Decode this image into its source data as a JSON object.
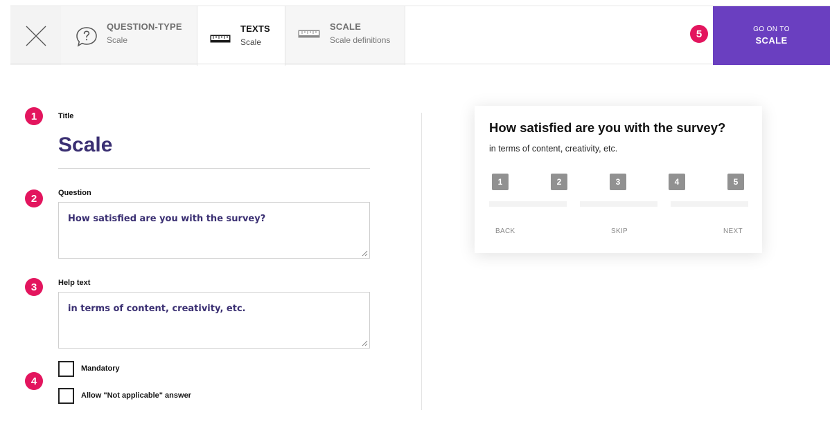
{
  "header": {
    "steps": [
      {
        "title": "QUESTION-TYPE",
        "subtitle": "Scale"
      },
      {
        "title": "TEXTS",
        "subtitle": "Scale"
      },
      {
        "title": "SCALE",
        "subtitle": "Scale definitions"
      }
    ],
    "goon_line1": "GO ON TO",
    "goon_line2": "SCALE"
  },
  "badges": [
    "1",
    "2",
    "3",
    "4",
    "5"
  ],
  "form": {
    "title_label": "Title",
    "title_value": "Scale",
    "question_label": "Question",
    "question_value": "How satisfied are you with the survey?",
    "help_label": "Help text",
    "help_value": "in terms of content, creativity, etc.",
    "mandatory_label": "Mandatory",
    "not_applicable_label": "Allow \"Not applicable\" answer"
  },
  "preview": {
    "question": "How satisfied are you with the survey?",
    "help": "in terms of content, creativity, etc.",
    "scale": [
      "1",
      "2",
      "3",
      "4",
      "5"
    ],
    "back": "BACK",
    "skip": "SKIP",
    "next": "NEXT"
  },
  "colors": {
    "accent": "#6a3fc0",
    "badge": "#e3155e",
    "title_text": "#3a2f72",
    "scale_box": "#919191"
  }
}
